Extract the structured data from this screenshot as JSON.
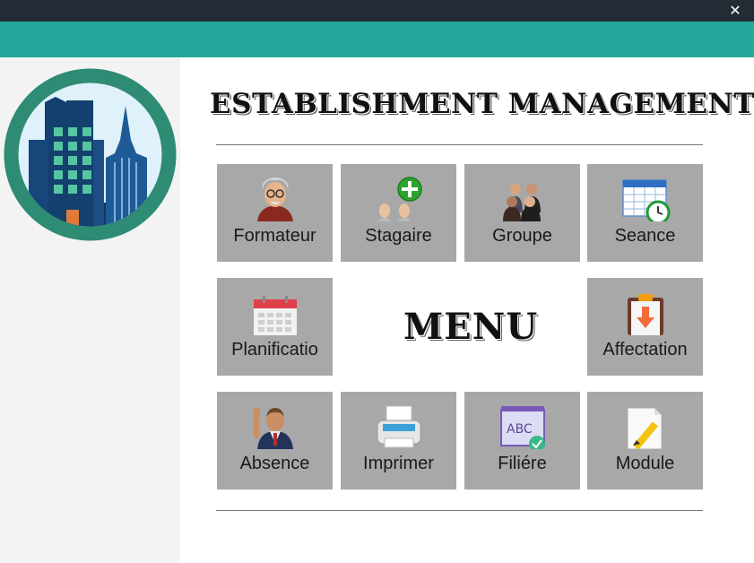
{
  "window": {
    "close_glyph": "✕"
  },
  "app": {
    "title": "ESTABLISHMENT MANAGEMENT",
    "menu_heading": "MENU"
  },
  "colors": {
    "titlebar": "#232c35",
    "accent": "#26a69a",
    "tile": "#a8a8a8",
    "sidebar": "#f3f3f3"
  },
  "tiles": [
    {
      "label": "Formateur",
      "icon": "teacher-icon"
    },
    {
      "label": "Stagaire",
      "icon": "add-trainee-icon"
    },
    {
      "label": "Groupe",
      "icon": "group-icon"
    },
    {
      "label": "Seance",
      "icon": "schedule-clock-icon"
    },
    {
      "label": "Planificatio",
      "icon": "calendar-icon"
    },
    {
      "label": "Affectation",
      "icon": "clipboard-download-icon"
    },
    {
      "label": "Absence",
      "icon": "raised-hand-person-icon"
    },
    {
      "label": "Imprimer",
      "icon": "printer-icon"
    },
    {
      "label": "Filiére",
      "icon": "abc-board-icon"
    },
    {
      "label": "Module",
      "icon": "note-pencil-icon"
    }
  ]
}
